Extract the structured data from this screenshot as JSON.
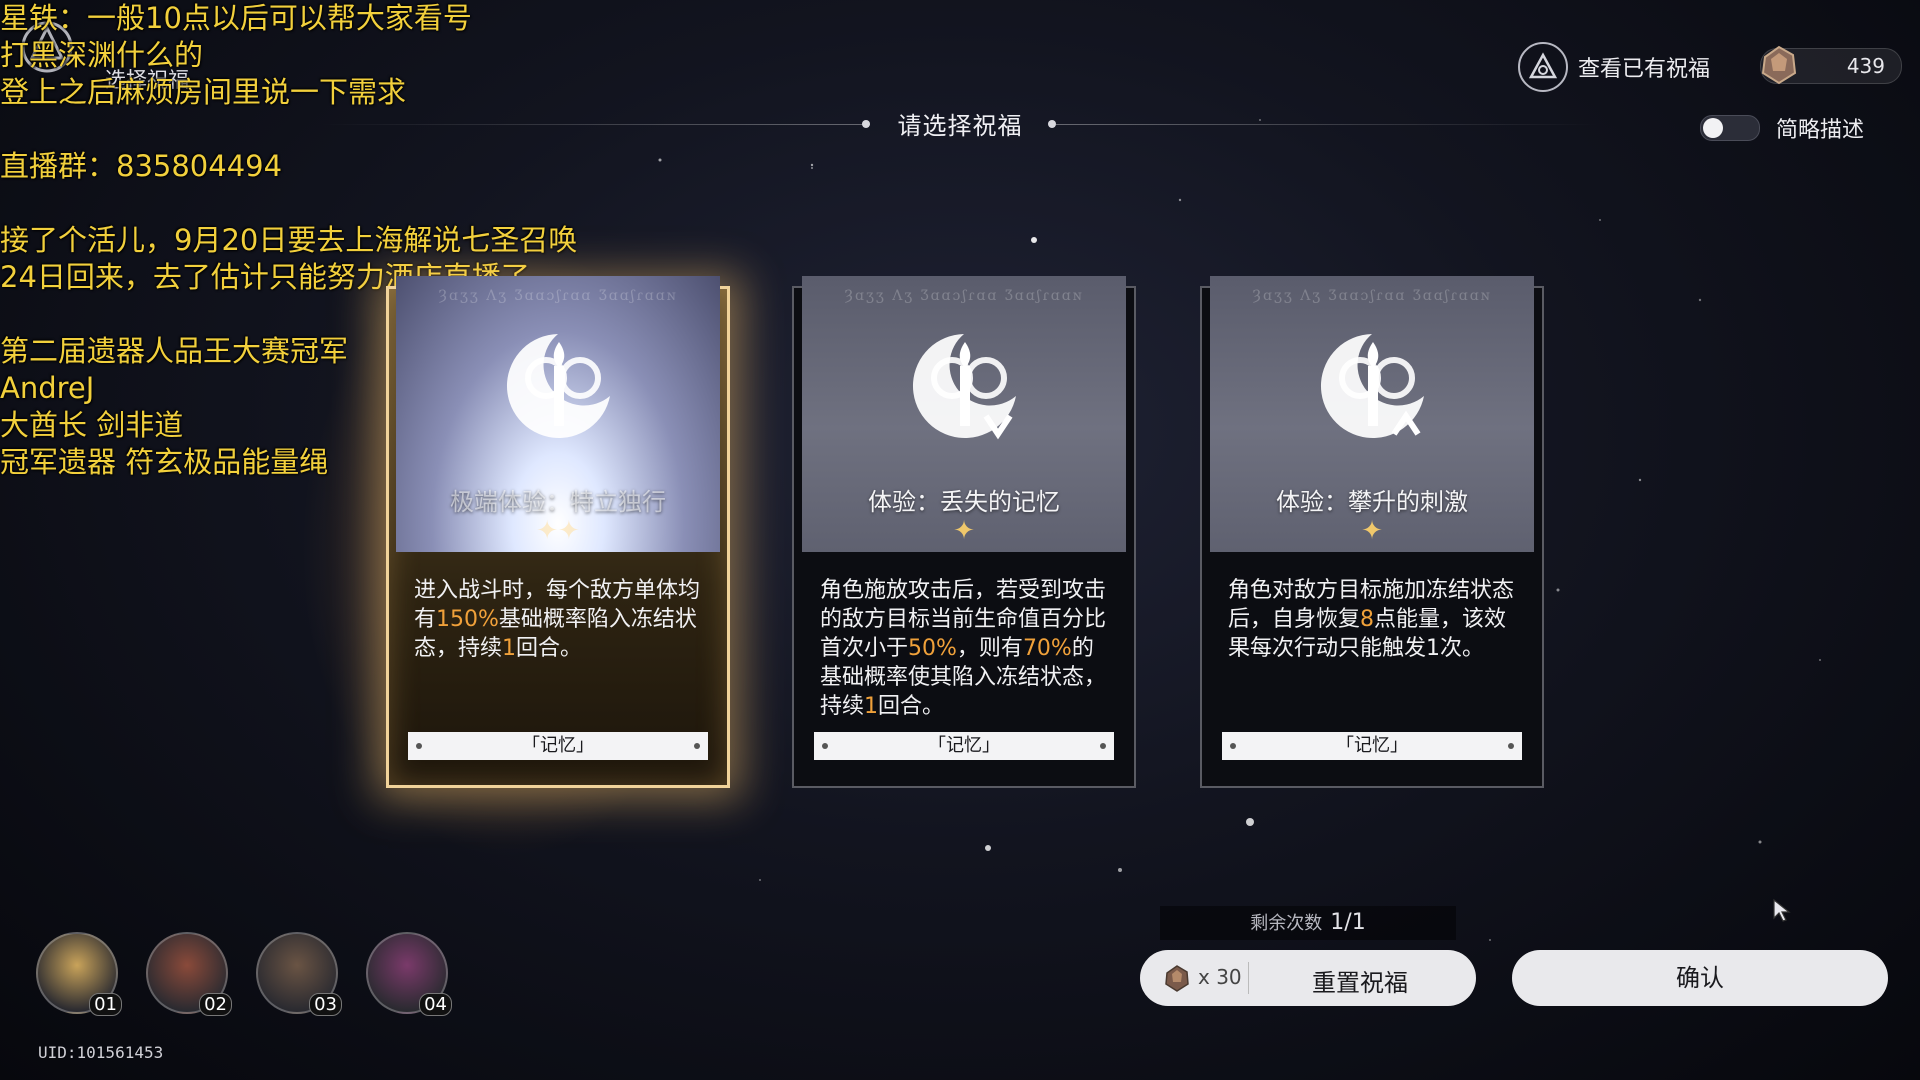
{
  "overlay": {
    "lines": [
      "星铁：一般10点以后可以帮大家看号",
      "打黑深渊什么的",
      "登上之后麻烦房间里说一下需求",
      "",
      "直播群：835804494",
      "",
      "接了个活儿，9月20日要去上海解说七圣召唤",
      "24日回来，去了估计只能努力酒店直播了",
      "",
      "第二届遗器人品王大赛冠军",
      "AndreJ",
      "大酋长  剑非道",
      "冠军遗器  符玄极品能量绳"
    ]
  },
  "header": {
    "mode_label": "选择祝福",
    "title": "请选择祝福",
    "view_blessings": "查看已有祝福",
    "currency_value": "439",
    "toggle_label": "简略描述"
  },
  "cards": [
    {
      "name": "极端体验：特立独行",
      "script": "Ȝɑʒʒ Λʒ Ʒɑɑɔʃɾɑɑ Ʒɑɑʃɾɑɑɴ",
      "desc_parts": [
        {
          "t": "进入战斗时，每个敌方单体均有"
        },
        {
          "t": "150%",
          "hl": true
        },
        {
          "t": "基础概率陷入冻结状态，持续"
        },
        {
          "t": "1",
          "hl": true
        },
        {
          "t": "回合。"
        }
      ],
      "sparkle": "✦✦",
      "path": "「记忆」"
    },
    {
      "name": "体验：丢失的记忆",
      "script": "Ȝɑʒʒ Λʒ Ʒɑɑɔʃɾɑɑ Ʒɑɑʃɾɑɑɴ",
      "desc_parts": [
        {
          "t": "角色施放攻击后，若受到攻击的敌方目标当前生命值百分比首次小于"
        },
        {
          "t": "50%",
          "hl": true
        },
        {
          "t": "，则有"
        },
        {
          "t": "70%",
          "hl": true
        },
        {
          "t": "的基础概率使其陷入冻结状态，持续"
        },
        {
          "t": "1",
          "hl": true
        },
        {
          "t": "回合。"
        }
      ],
      "sparkle": "✦",
      "path": "「记忆」"
    },
    {
      "name": "体验：攀升的刺激",
      "script": "Ȝɑʒʒ Λʒ Ʒɑɑɔʃɾɑɑ Ʒɑɑʃɾɑɑɴ",
      "desc_parts": [
        {
          "t": "角色对敌方目标施加冻结状态后，自身恢复"
        },
        {
          "t": "8",
          "hl": true
        },
        {
          "t": "点能量，该效果每次行动只能触发1次。"
        }
      ],
      "sparkle": "✦",
      "path": "「记忆」"
    }
  ],
  "party": [
    {
      "num": "01",
      "color": "#c9a35a"
    },
    {
      "num": "02",
      "color": "#8a4a3a"
    },
    {
      "num": "03",
      "color": "#6a5444"
    },
    {
      "num": "04",
      "color": "#7a3a6a"
    }
  ],
  "uid": "UID:101561453",
  "footer": {
    "remaining_label": "剩余次数",
    "remaining_value": "1/1",
    "reset_cost": "x 30",
    "reset_label": "重置祝福",
    "confirm_label": "确认"
  },
  "colors": {
    "highlight": "#f0a13a",
    "overlay_text": "#f2d03c",
    "selected_border": "#f1d39a"
  }
}
